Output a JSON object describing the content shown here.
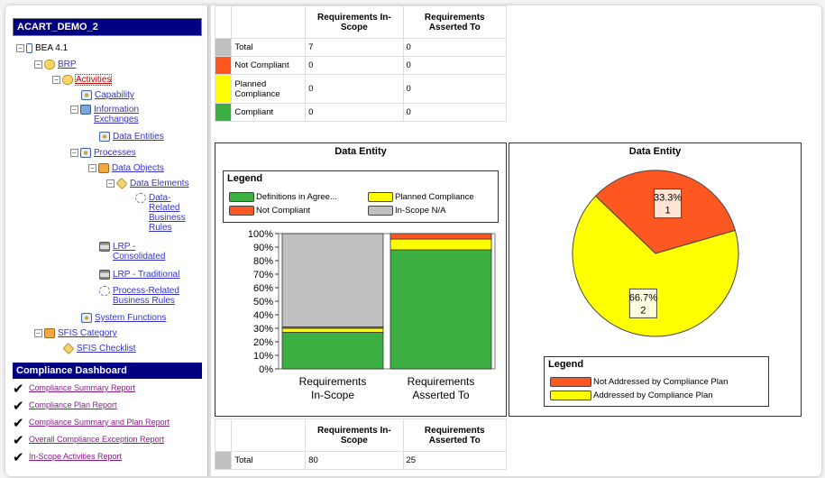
{
  "tree": {
    "title": "ACART_DEMO_2",
    "nodes": [
      {
        "id": "n0",
        "label": "BEA 4.1",
        "link": false
      },
      {
        "id": "n1",
        "label": "BRP",
        "link": true
      },
      {
        "id": "n2",
        "label": "Activities",
        "link": true,
        "selected": true
      },
      {
        "id": "n3",
        "label": "Capability",
        "link": true
      },
      {
        "id": "n4",
        "label": "Information Exchanges",
        "link": true
      },
      {
        "id": "n5",
        "label": "Data Entities",
        "link": true
      },
      {
        "id": "n6",
        "label": "Processes",
        "link": true
      },
      {
        "id": "n7",
        "label": "Data Objects",
        "link": true
      },
      {
        "id": "n8",
        "label": "Data Elements",
        "link": true
      },
      {
        "id": "n9",
        "label": "Data-Related Business Rules",
        "link": true
      },
      {
        "id": "n10",
        "label": "LRP - Consolidated",
        "link": true
      },
      {
        "id": "n11",
        "label": "LRP - Traditional",
        "link": true
      },
      {
        "id": "n12",
        "label": "Process-Related Business Rules",
        "link": true
      },
      {
        "id": "n13",
        "label": "System Functions",
        "link": true
      },
      {
        "id": "n14",
        "label": "SFIS Category",
        "link": true
      },
      {
        "id": "n15",
        "label": "SFIS Checklist",
        "link": true
      }
    ]
  },
  "dashboard": {
    "title": "Compliance Dashboard",
    "reports": [
      "Compliance Summary Report",
      "Compliance Plan Report",
      "Compliance Summary and Plan Report",
      "Overall Compliance Exception Report",
      "In-Scope Activities Report"
    ]
  },
  "top_table": {
    "headers": [
      "Requirements In-Scope",
      "Requirements Asserted To"
    ],
    "rows": [
      {
        "label": "Total",
        "color": "#c0c0c0",
        "a": "7",
        "b": "0"
      },
      {
        "label": "Not Compliant",
        "color": "#ff5722",
        "a": "0",
        "b": "0"
      },
      {
        "label": "Planned Compliance",
        "color": "#ffff00",
        "a": "0",
        "b": "0"
      },
      {
        "label": "Compliant",
        "color": "#3cb043",
        "a": "0",
        "b": "0"
      }
    ]
  },
  "bottom_table": {
    "headers": [
      "Requirements In-Scope",
      "Requirements Asserted To"
    ],
    "rows": [
      {
        "label": "Total",
        "color": "#c0c0c0",
        "a": "80",
        "b": "25"
      }
    ]
  },
  "bar_panel": {
    "title": "Data Entity",
    "legend_title": "Legend",
    "legend": [
      {
        "label": "Definitions in Agree...",
        "color": "#3cb043"
      },
      {
        "label": "Planned Compliance",
        "color": "#ffff00"
      },
      {
        "label": "Not Compliant",
        "color": "#ff5722"
      },
      {
        "label": "In-Scope N/A",
        "color": "#c0c0c0"
      }
    ]
  },
  "pie_panel": {
    "title": "Data Entity",
    "legend_title": "Legend",
    "legend": [
      {
        "label": "Not Addressed by Compliance Plan",
        "color": "#ff5722"
      },
      {
        "label": "Addressed by Compliance Plan",
        "color": "#ffff00"
      }
    ]
  },
  "chart_data": [
    {
      "type": "bar",
      "title": "Data Entity",
      "stacked": true,
      "categories": [
        "Requirements In-Scope",
        "Requirements Asserted To"
      ],
      "yticks": [
        "0%",
        "10%",
        "20%",
        "30%",
        "40%",
        "50%",
        "60%",
        "70%",
        "80%",
        "90%",
        "100%"
      ],
      "ylim": [
        0,
        100
      ],
      "series": [
        {
          "name": "Definitions in Agree...",
          "color": "#3cb043",
          "values": [
            27,
            88
          ]
        },
        {
          "name": "Planned Compliance",
          "color": "#ffff00",
          "values": [
            3,
            8
          ]
        },
        {
          "name": "Not Compliant",
          "color": "#ff5722",
          "values": [
            1,
            4
          ]
        },
        {
          "name": "In-Scope N/A",
          "color": "#c0c0c0",
          "values": [
            69,
            0
          ]
        }
      ]
    },
    {
      "type": "pie",
      "title": "Data Entity",
      "slices": [
        {
          "name": "Addressed by Compliance Plan",
          "color": "#ffff00",
          "value": 2,
          "label": "66.7%",
          "count": "2"
        },
        {
          "name": "Not Addressed by Compliance Plan",
          "color": "#ff5722",
          "value": 1,
          "label": "33.3%",
          "count": "1"
        }
      ]
    }
  ]
}
